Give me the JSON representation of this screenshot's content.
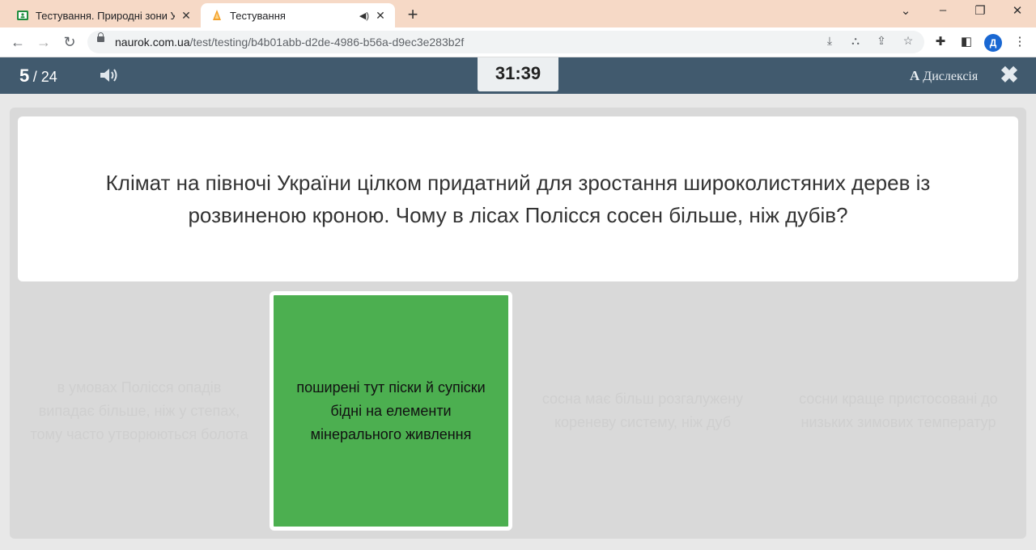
{
  "browser": {
    "tabs": [
      {
        "title": "Тестування. Природні зони Укр",
        "close": "✕"
      },
      {
        "title": "Тестування",
        "close": "✕"
      }
    ],
    "new_tab": "+",
    "url_host": "naurok.com.ua",
    "url_path": "/test/testing/b4b01abb-d2de-4986-b56a-d9ec3e283b2f",
    "profile_initial": "Д"
  },
  "quiz": {
    "current": "5",
    "total": "/ 24",
    "timer": "31:39",
    "dyslexia_a": "A",
    "dyslexia_label": "Дислексія",
    "close": "✖",
    "question": "Клімат на півночі України цілком придатний для зростання широколистяних дерев із розвиненою кроною. Чому в лісах Полісся сосен більше, ніж дубів?",
    "answers": [
      {
        "text": "в умовах Полісся опадів випадає більше, ніж у степах, тому часто утворюються болота",
        "state": "faded"
      },
      {
        "text": "поширені тут піски й супіски бідні на елементи мінерального живлення",
        "state": "selected"
      },
      {
        "text": "сосна має більш розгалужену кореневу систему, ніж дуб",
        "state": "faded"
      },
      {
        "text": "сосни краще пристосовані до низьких зимових температур",
        "state": "faded"
      }
    ]
  },
  "colors": {
    "header": "#415a6e",
    "selected_answer": "#4caf50",
    "tabbar": "#f6d9c6"
  }
}
